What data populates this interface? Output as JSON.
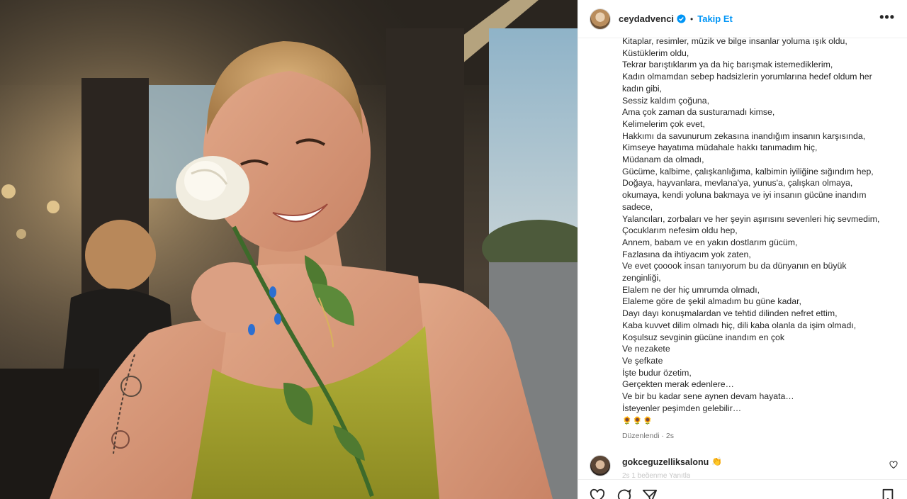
{
  "post": {
    "username": "ceydadvenci",
    "dot": "•",
    "follow_label": "Takip Et",
    "more_label": "•••",
    "caption_lines": [
      "Kitaplar, resimler, müzik ve bilge insanlar yoluma ışık oldu,",
      "Küstüklerim oldu,",
      "Tekrar barıştıklarım ya da hiç barışmak istemediklerim,",
      "Kadın olmamdan sebep hadsizlerin yorumlarına hedef oldum her",
      "kadın gibi,",
      "Sessiz kaldım çoğuna,",
      "Ama çok zaman da susturamadı kimse,",
      "Kelimelerim çok evet,",
      "Hakkımı da savunurum zekasına inandığım insanın karşısında,",
      "Kimseye hayatıma müdahale hakkı tanımadım hiç,",
      "Müdanam da olmadı,",
      "Gücüme, kalbime, çalışkanlığıma, kalbimin iyiliğine sığındım hep,",
      "Doğaya, hayvanlara, mevlana'ya, yunus'a, çalışkan olmaya,",
      "okumaya, kendi yoluna bakmaya ve iyi insanın gücüne inandım",
      "sadece,",
      "Yalancıları, zorbaları ve her şeyin aşırısını sevenleri hiç sevmedim,",
      "Çocuklarım nefesim oldu hep,",
      "Annem, babam ve en yakın dostlarım gücüm,",
      "Fazlasına da ihtiyacım yok zaten,",
      "Ve evet çooook insan tanıyorum bu da dünyanın en büyük",
      "zenginliği,",
      "Elalem ne der hiç umrumda olmadı,",
      "Elaleme göre de şekil almadım bu güne kadar,",
      "Dayı dayı konuşmalardan ve tehtid dilinden nefret ettim,",
      "Kaba kuvvet dilim olmadı hiç, dili kaba olanla da işim olmadı,",
      "Koşulsuz sevginin gücüne inandım en çok",
      "Ve nezakete",
      "Ve şefkate",
      "İşte budur özetim,",
      "Gerçekten merak edenlere…",
      "Ve bir bu kadar sene aynen devam hayata…",
      "İsteyenler peşimden gelebilir…"
    ],
    "emojis": "🌻🌻🌻",
    "edited_label": "Düzenlendi · 2s"
  },
  "comment": {
    "username": "gokceguzelliksalonu",
    "emoji": "👏",
    "meta": "2s  1 beğenme  Yanıtla"
  },
  "icons": [
    "heart-icon",
    "comment-icon",
    "share-icon",
    "bookmark-icon",
    "verified-badge-icon"
  ],
  "colors": {
    "follow": "#0095f6",
    "verified": "#0095f6",
    "dress": "#9a9a2a",
    "text": "#262626"
  }
}
